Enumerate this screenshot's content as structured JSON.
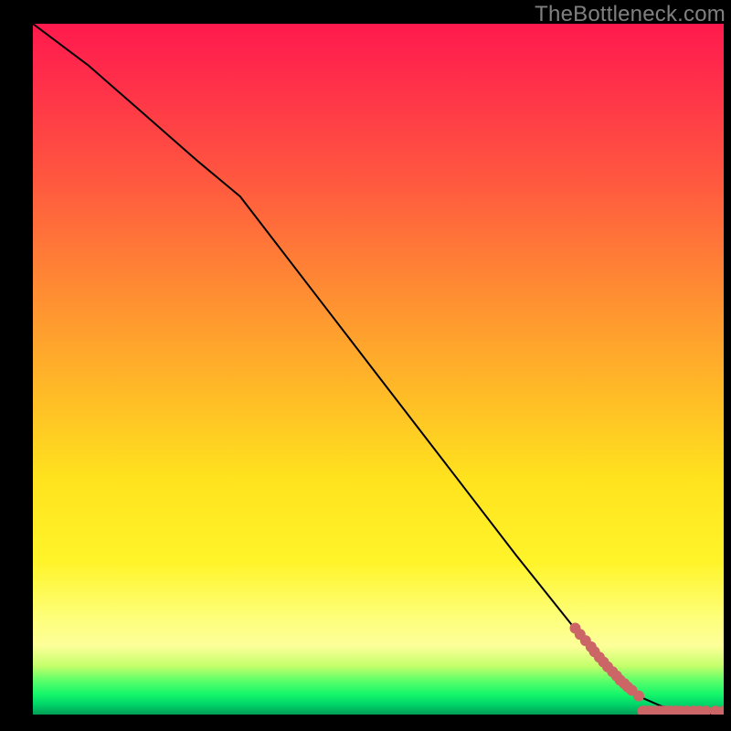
{
  "branding": {
    "watermark": "TheBottleneck.com"
  },
  "chart_data": {
    "type": "line",
    "title": "",
    "xlabel": "",
    "ylabel": "",
    "xlim": [
      0,
      100
    ],
    "ylim": [
      0,
      100
    ],
    "grid": false,
    "legend": false,
    "series": [
      {
        "name": "curve",
        "kind": "line",
        "x": [
          0,
          8,
          16,
          24,
          30,
          40,
          50,
          60,
          70,
          78,
          84,
          88,
          91,
          94,
          96,
          98,
          100
        ],
        "y": [
          100,
          94,
          87,
          80,
          75,
          62,
          49,
          36,
          23,
          13,
          6,
          2.5,
          1.2,
          0.6,
          0.3,
          0.1,
          0
        ]
      },
      {
        "name": "points-on-slope",
        "kind": "scatter",
        "x": [
          78.5,
          79.2,
          80.0,
          80.8,
          81.3,
          82.0,
          82.6,
          83.2,
          83.9,
          84.5,
          85.0,
          85.6,
          86.1,
          86.7,
          87.7
        ],
        "y": [
          12.5,
          11.6,
          10.7,
          9.8,
          9.1,
          8.3,
          7.6,
          6.9,
          6.2,
          5.6,
          5.0,
          4.5,
          4.0,
          3.5,
          2.7
        ]
      },
      {
        "name": "points-on-flat",
        "kind": "scatter",
        "x": [
          88.3,
          88.8,
          89.3,
          90.0,
          90.7,
          91.2,
          91.8,
          92.4,
          93.1,
          93.7,
          94.6,
          95.6,
          96.4,
          97.4,
          98.8,
          100.0
        ],
        "y": [
          0.5,
          0.5,
          0.5,
          0.5,
          0.5,
          0.5,
          0.5,
          0.5,
          0.5,
          0.5,
          0.5,
          0.5,
          0.5,
          0.5,
          0.5,
          0.5
        ]
      }
    ],
    "background_gradient": {
      "direction": "top-to-bottom",
      "stops": [
        {
          "pos": 0.0,
          "color": "#ff1a4d"
        },
        {
          "pos": 0.38,
          "color": "#ff8a33"
        },
        {
          "pos": 0.66,
          "color": "#ffe31e"
        },
        {
          "pos": 0.9,
          "color": "#fdff99"
        },
        {
          "pos": 0.95,
          "color": "#5fff6a"
        },
        {
          "pos": 1.0,
          "color": "#009e56"
        }
      ]
    }
  }
}
